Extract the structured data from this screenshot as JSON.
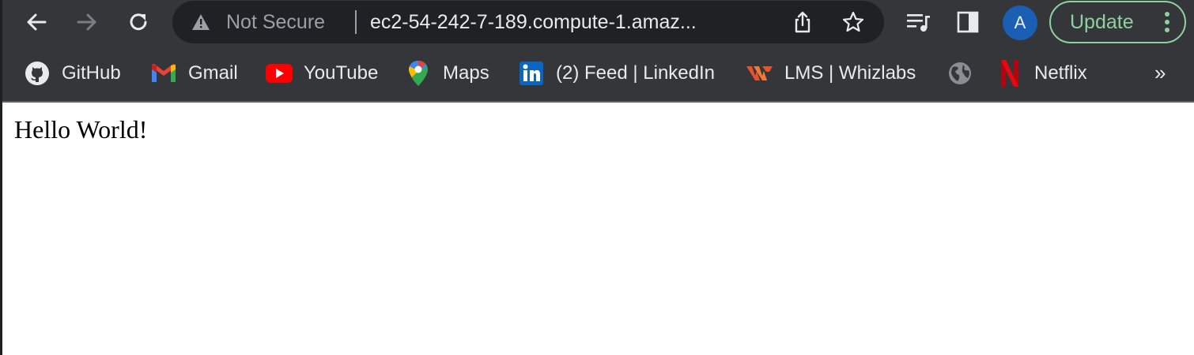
{
  "toolbar": {
    "back_icon": "arrow-left-icon",
    "forward_icon": "arrow-right-icon",
    "reload_icon": "reload-icon"
  },
  "omnibox": {
    "security_icon": "warning-icon",
    "security_text": "Not Secure",
    "url": "ec2-54-242-7-189.compute-1.amaz...",
    "share_icon": "share-icon",
    "bookmark_icon": "star-icon"
  },
  "actions": {
    "media_icon": "media-queue-icon",
    "sidepanel_icon": "side-panel-icon",
    "avatar_letter": "A",
    "update_label": "Update",
    "menu_icon": "kebab-menu-icon"
  },
  "bookmarks": [
    {
      "label": "GitHub",
      "icon": "github-icon"
    },
    {
      "label": "Gmail",
      "icon": "gmail-icon"
    },
    {
      "label": "YouTube",
      "icon": "youtube-icon"
    },
    {
      "label": "Maps",
      "icon": "maps-icon"
    },
    {
      "label": "(2) Feed | LinkedIn",
      "icon": "linkedin-icon"
    },
    {
      "label": "LMS | Whizlabs",
      "icon": "whizlabs-icon"
    },
    {
      "label": "",
      "icon": "globe-icon"
    },
    {
      "label": "Netflix",
      "icon": "netflix-icon"
    }
  ],
  "bookmarks_overflow": "»",
  "page": {
    "body_text": "Hello World!"
  },
  "colors": {
    "chrome_bg": "#35363a",
    "omnibox_bg": "#202124",
    "update_green": "#8fd19e",
    "avatar_blue": "#1a5fb4"
  }
}
